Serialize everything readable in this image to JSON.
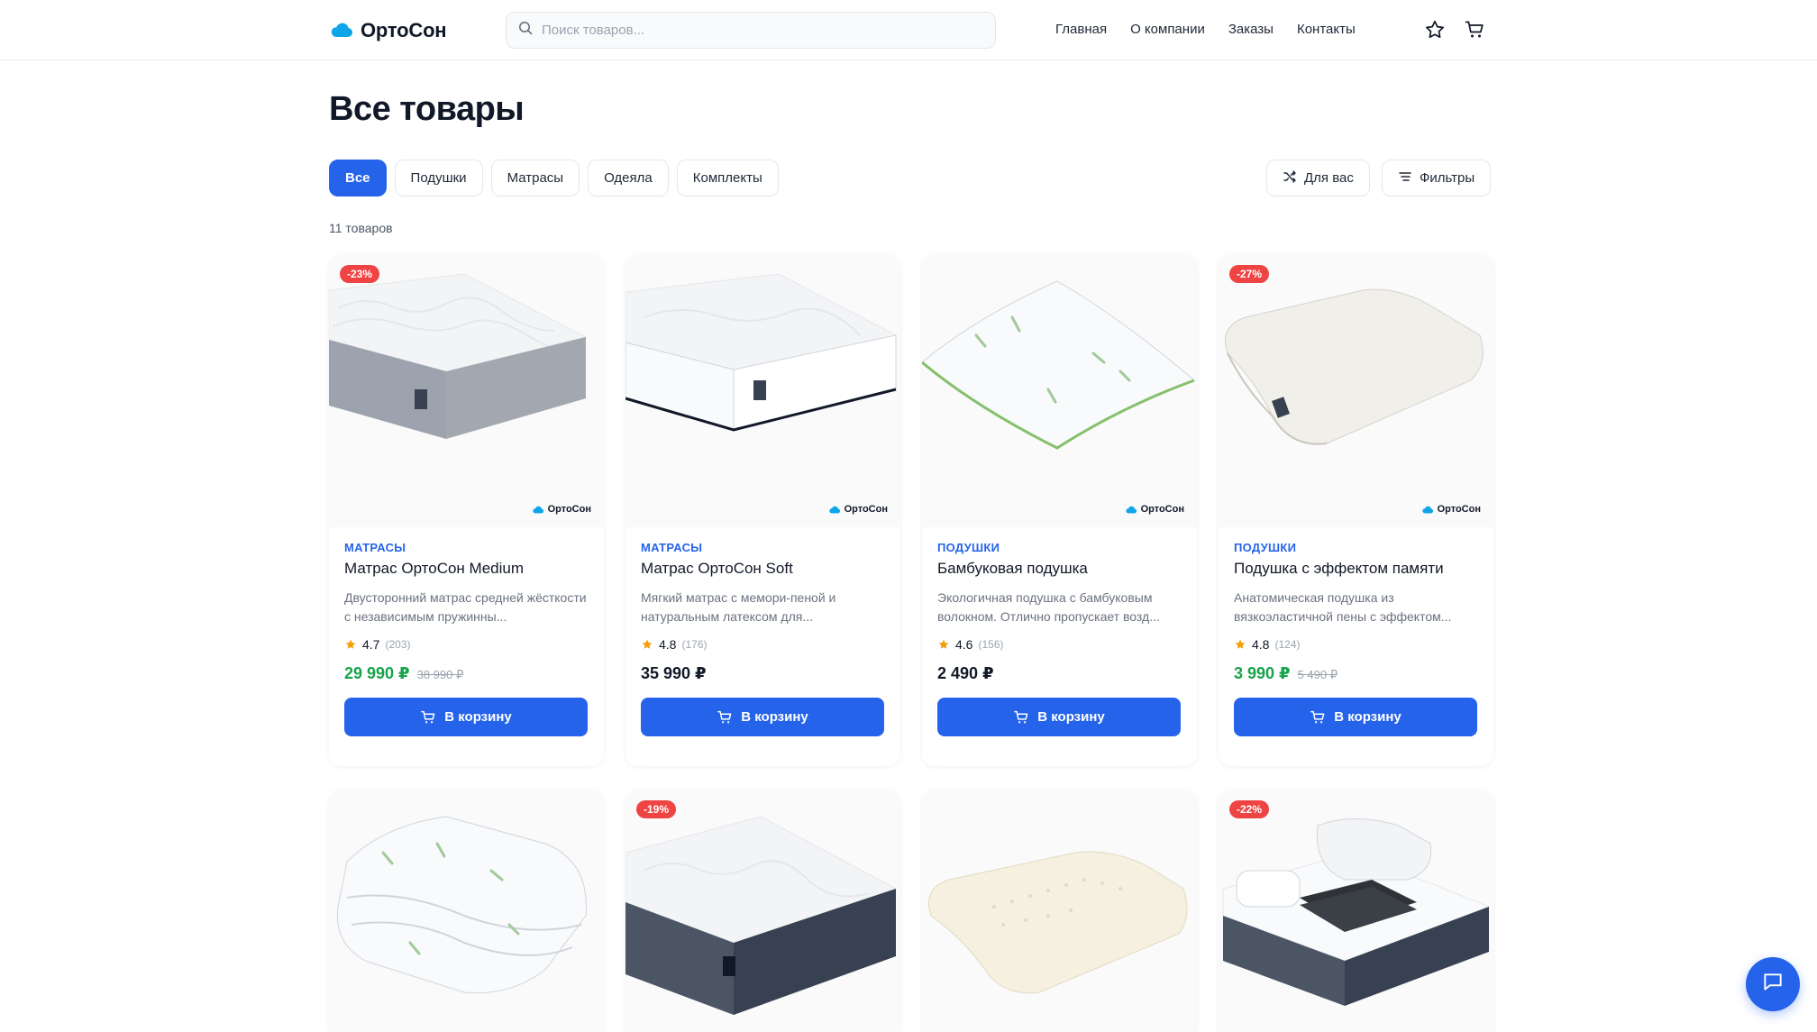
{
  "header": {
    "logo_text": "ОртоСон",
    "search_placeholder": "Поиск товаров...",
    "nav": [
      "Главная",
      "О компании",
      "Заказы",
      "Контакты"
    ]
  },
  "page": {
    "title": "Все товары",
    "count": "11 товаров"
  },
  "filters": {
    "chips": [
      "Все",
      "Подушки",
      "Матрасы",
      "Одеяла",
      "Комплекты"
    ],
    "active": "Все",
    "for_you": "Для вас",
    "filters": "Фильтры"
  },
  "cart_label": "В корзину",
  "brand_mark": "ОртоСон",
  "products": [
    {
      "badge": "-23%",
      "category": "МАТРАСЫ",
      "name": "Матрас ОртоСон Medium",
      "description": "Двусторонний матрас средней жёсткости с независимым пружинны...",
      "rating": "4.7",
      "reviews": "(203)",
      "price": "29 990 ₽",
      "old_price": "38 990 ₽",
      "image": "mattress-grey-icon"
    },
    {
      "badge": "",
      "category": "МАТРАСЫ",
      "name": "Матрас ОртоСон Soft",
      "description": "Мягкий матрас с мемори-пеной и натуральным латексом для...",
      "rating": "4.8",
      "reviews": "(176)",
      "price": "35 990 ₽",
      "old_price": "",
      "image": "mattress-white-icon"
    },
    {
      "badge": "",
      "category": "ПОДУШКИ",
      "name": "Бамбуковая подушка",
      "description": "Экологичная подушка с бамбуковым волокном. Отлично пропускает возд...",
      "rating": "4.6",
      "reviews": "(156)",
      "price": "2 490 ₽",
      "old_price": "",
      "image": "pillow-bamboo-icon"
    },
    {
      "badge": "-27%",
      "category": "ПОДУШКИ",
      "name": "Подушка с эффектом памяти",
      "description": "Анатомическая подушка из вязкоэластичной пены с эффектом...",
      "rating": "4.8",
      "reviews": "(124)",
      "price": "3 990 ₽",
      "old_price": "5 490 ₽",
      "image": "pillow-memory-icon"
    },
    {
      "badge": "",
      "image": "blanket-bamboo-icon"
    },
    {
      "badge": "-19%",
      "image": "mattress-dark-icon"
    },
    {
      "badge": "",
      "image": "pillow-latex-icon"
    },
    {
      "badge": "-22%",
      "image": "bedding-set-icon"
    }
  ],
  "colors": {
    "accent": "#2563eb",
    "sale": "#16a34a",
    "badge": "#ef4444",
    "star": "#f59e0b"
  }
}
